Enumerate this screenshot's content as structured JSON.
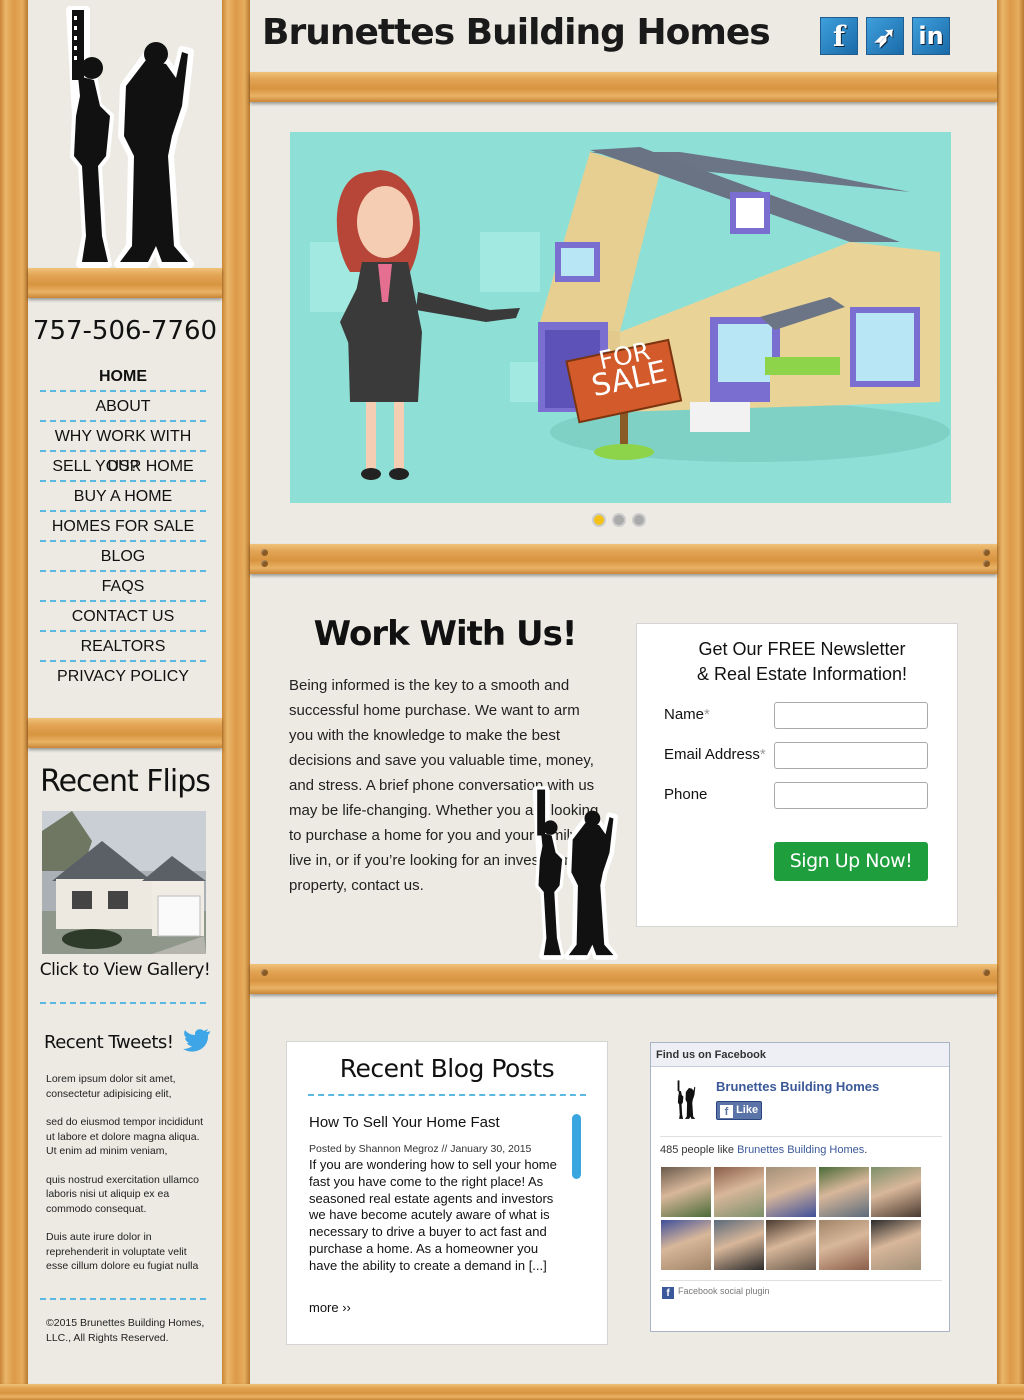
{
  "site": {
    "title": "Brunettes Building Homes",
    "phone": "757-506-7760"
  },
  "social": [
    {
      "name": "facebook-icon",
      "glyph": "f"
    },
    {
      "name": "twitter-icon",
      "glyph": "➶"
    },
    {
      "name": "linkedin-icon",
      "glyph": "in"
    }
  ],
  "nav": [
    "HOME",
    "ABOUT",
    "WHY WORK WITH US?",
    "SELL YOUR HOME",
    "BUY A HOME",
    "HOMES FOR SALE",
    "BLOG",
    "FAQS",
    "CONTACT US",
    "REALTORS",
    "PRIVACY POLICY"
  ],
  "hero": {
    "sign_line1": "FOR",
    "sign_line2": "SALE",
    "active_slide": 1,
    "slide_count": 3
  },
  "flips": {
    "heading": "Recent Flips",
    "link": "Click to View Gallery!"
  },
  "tweets": {
    "heading": "Recent Tweets!",
    "items": [
      "Lorem ipsum dolor sit amet, consectetur adipisicing elit,",
      "sed do eiusmod tempor incididunt ut labore et dolore magna aliqua. Ut enim ad minim veniam,",
      "quis nostrud exercitation ullamco laboris nisi ut aliquip ex ea commodo consequat.",
      "Duis aute irure dolor in reprehenderit in voluptate velit esse cillum dolore eu fugiat nulla"
    ]
  },
  "copyright": "©2015 Brunettes Building Homes, LLC., All Rights Reserved.",
  "work": {
    "heading": "Work With Us!",
    "body": "Being informed is the key to a smooth and successful home purchase. We want to arm you with the knowledge to make the best decisions and save you valuable time, money, and stress. A brief phone conversation with us may be life-changing. Whether you are looking to purchase a home for you and your family to live in, or if you’re looking for an investment property, contact us."
  },
  "newsletter": {
    "heading1": "Get Our FREE Newsletter",
    "heading2": "& Real Estate Information!",
    "name_label": "Name",
    "email_label": "Email Address",
    "phone_label": "Phone",
    "required": "*",
    "button": "Sign Up Now!"
  },
  "blog": {
    "heading": "Recent Blog Posts",
    "post_title": "How To Sell Your Home Fast",
    "meta": "Posted by Shannon Megroz // January 30, 2015",
    "excerpt": "If you are wondering how to sell your home fast you have come to the right place!  As seasoned real estate agents and investors we have become acutely aware of what is necessary to drive a buyer to act fast and purchase a home. As a homeowner you have the ability to create a demand in [...]",
    "more": "more ››"
  },
  "facebook": {
    "header": "Find us on Facebook",
    "page_name": "Brunettes Building Homes",
    "like": "Like",
    "count_text": "485 people like ",
    "count_link": "Brunettes Building Homes",
    "count_end": ".",
    "plugin": "Facebook social plugin"
  },
  "colors": {
    "accent": "#5ab9e0",
    "button": "#1e9e3c",
    "wood": "#e2a454",
    "fb_blue": "#3b5998",
    "dot_active": "#f2c21b"
  }
}
